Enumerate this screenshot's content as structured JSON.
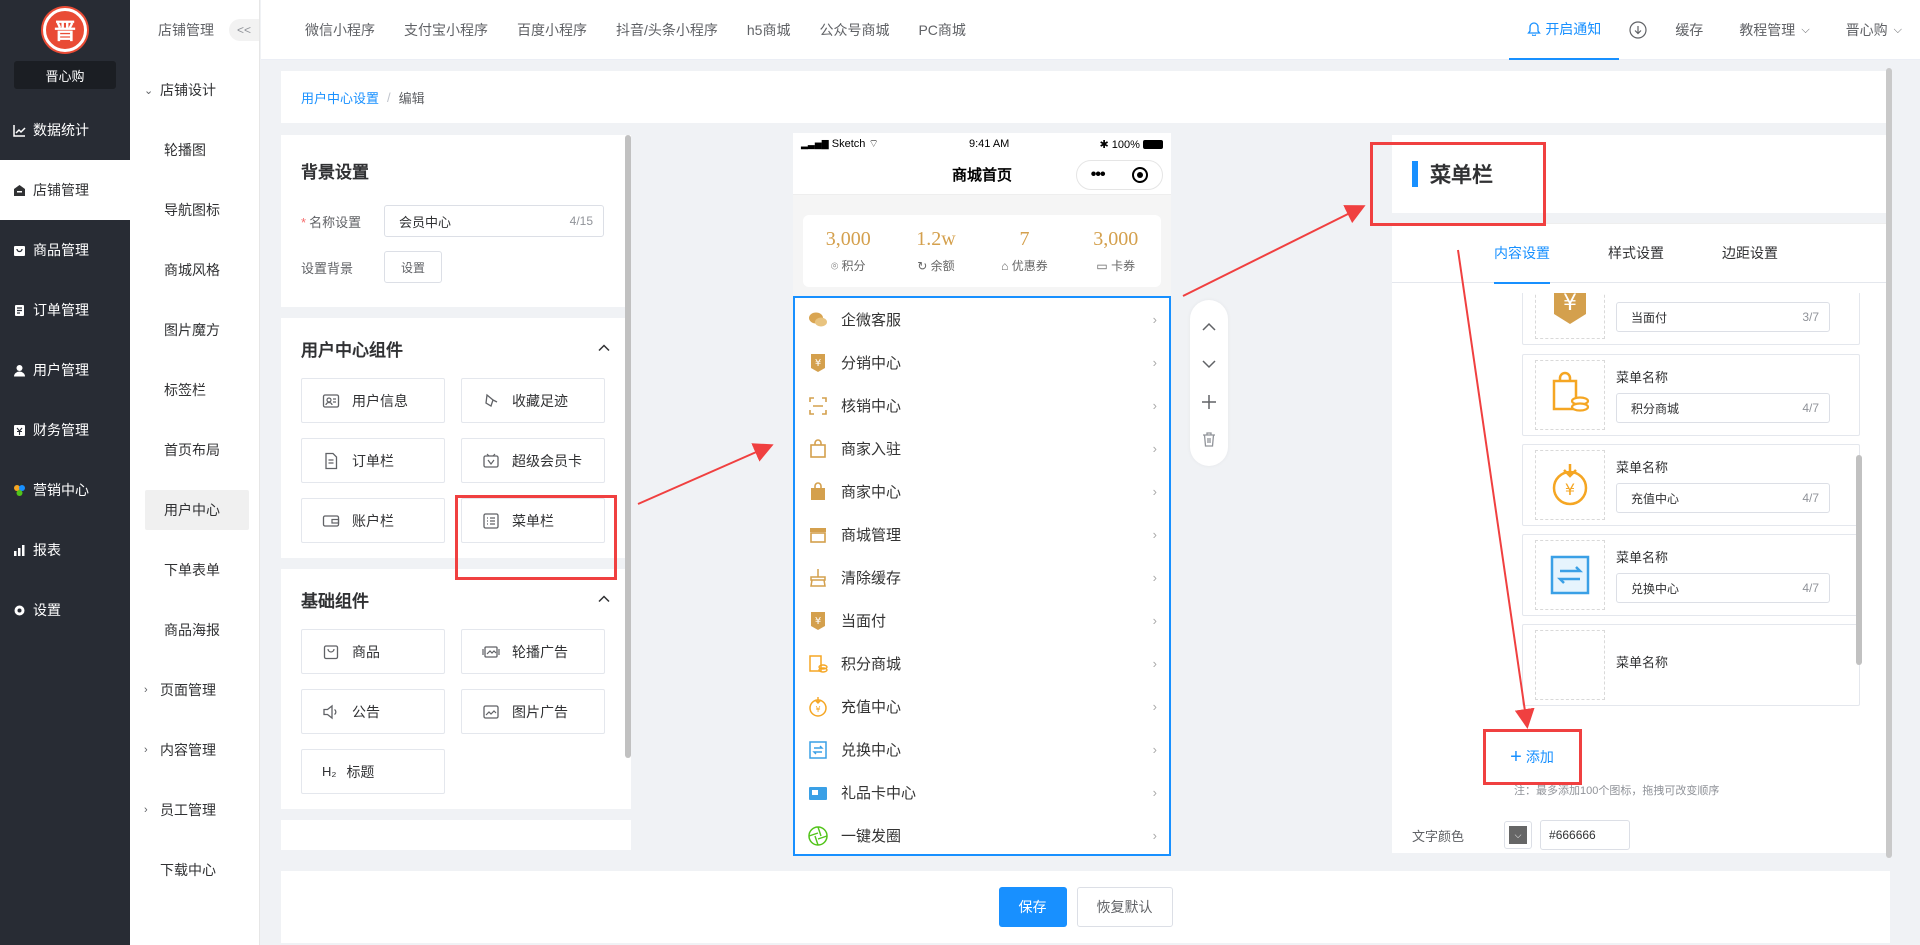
{
  "sidebar": {
    "shop_name": "晋心购",
    "logo_char": "晋",
    "items": [
      {
        "label": "数据统计",
        "icon": "chart-icon"
      },
      {
        "label": "店铺管理",
        "icon": "shop-icon",
        "active": true
      },
      {
        "label": "商品管理",
        "icon": "goods-icon"
      },
      {
        "label": "订单管理",
        "icon": "order-icon"
      },
      {
        "label": "用户管理",
        "icon": "user-icon"
      },
      {
        "label": "财务管理",
        "icon": "finance-icon"
      },
      {
        "label": "营销中心",
        "icon": "marketing-icon"
      },
      {
        "label": "报表",
        "icon": "report-icon"
      },
      {
        "label": "设置",
        "icon": "settings-icon"
      }
    ]
  },
  "subside": {
    "title": "店铺管理",
    "collapse": "<<",
    "group1": "店铺设计",
    "items": [
      "轮播图",
      "导航图标",
      "商城风格",
      "图片魔方",
      "标签栏",
      "首页布局",
      "用户中心",
      "下单表单",
      "商品海报"
    ],
    "group2": "页面管理",
    "group3": "内容管理",
    "group4": "员工管理",
    "tail": "下载中心"
  },
  "topbar": {
    "tabs": [
      "微信小程序",
      "支付宝小程序",
      "百度小程序",
      "抖音/头条小程序",
      "h5商城",
      "公众号商城",
      "PC商城"
    ],
    "notify": "开启通知",
    "cache": "缓存",
    "tutorial": "教程管理",
    "user": "晋心购"
  },
  "breadcrumb": {
    "parent": "用户中心设置",
    "sep": "/",
    "current": "编辑"
  },
  "left": {
    "bg_title": "背景设置",
    "name_label": "名称设置",
    "name_required": "*",
    "name_value": "会员中心",
    "name_count": "4/15",
    "bg_label": "设置背景",
    "bg_button": "设置",
    "uc_title": "用户中心组件",
    "uc_components": [
      "用户信息",
      "收藏足迹",
      "订单栏",
      "超级会员卡",
      "账户栏",
      "菜单栏"
    ],
    "basic_title": "基础组件",
    "basic_components": [
      "商品",
      "轮播广告",
      "公告",
      "图片广告",
      "标题"
    ],
    "title_prefix": "H₂"
  },
  "phone": {
    "carrier": "Sketch",
    "time": "9:41 AM",
    "battery": "100%",
    "page_title": "商城首页",
    "stats": [
      {
        "value": "3,000",
        "label": "积分"
      },
      {
        "value": "1.2w",
        "label": "余额"
      },
      {
        "value": "7",
        "label": "优惠券"
      },
      {
        "value": "3,000",
        "label": "卡券"
      }
    ],
    "menu": [
      "企微客服",
      "分销中心",
      "核销中心",
      "商家入驻",
      "商家中心",
      "商城管理",
      "清除缓存",
      "当面付",
      "积分商城",
      "充值中心",
      "兑换中心",
      "礼品卡中心",
      "一键发圈"
    ]
  },
  "right": {
    "title": "菜单栏",
    "tabs": [
      "内容设置",
      "样式设置",
      "边距设置"
    ],
    "field_label": "菜单名称",
    "items": [
      {
        "value": "当面付",
        "count": "3/7"
      },
      {
        "value": "积分商城",
        "count": "4/7"
      },
      {
        "value": "充值中心",
        "count": "4/7"
      },
      {
        "value": "兑换中心",
        "count": "4/7"
      }
    ],
    "add_label": "添加",
    "note": "注：最多添加100个图标，拖拽可改变顺序",
    "color_label": "文字颜色",
    "color_value": "#666666"
  },
  "footer": {
    "save": "保存",
    "reset": "恢复默认"
  },
  "colors": {
    "primary": "#1890ff",
    "annotation": "#f04040",
    "sidebar": "#282c34",
    "gold": "#d4a04d"
  }
}
